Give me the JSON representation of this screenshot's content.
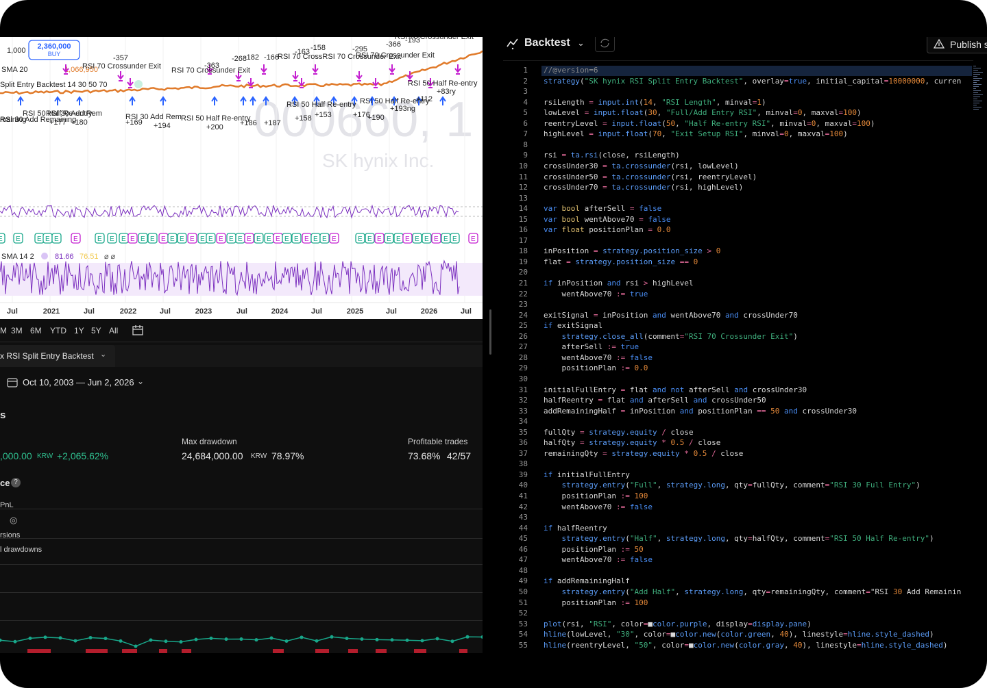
{
  "chart": {
    "price_scale_label": "1,000",
    "order_badge": {
      "value": "2,360,000",
      "side": "BUY"
    },
    "watermark_ticker": "000660, 1",
    "watermark_name": "SK hynix Inc.",
    "sma_label": "SMA 20",
    "sma_value": "1,066,950",
    "strategy_overlay_label": "Split Entry Backtest 14 30 50 70",
    "rsi_pane_label": "SMA 14 2",
    "rsi_value_1": "81.66",
    "rsi_value_2": "76.51",
    "x_axis": [
      "Jul",
      "2021",
      "Jul",
      "2022",
      "Jul",
      "2023",
      "Jul",
      "2024",
      "Jul",
      "2025",
      "Jul",
      "2026",
      "Jul"
    ],
    "trade_labels": [
      "-357",
      "RSI 70 Crossunder Exit",
      "RSI 70 Crossunder Exit",
      "-363",
      "-268",
      "-182",
      "-166",
      "-163",
      "-158",
      "RSI 70 CrossRSI 70 Crossunder Exit",
      "-295",
      "RSI 70 Crossunder Exit",
      "-366",
      "-193",
      "RSI 70 Crossunder Exit",
      "RSI 50 Half Re-entry",
      "RSI 50 Half Re-entry",
      "+83ry",
      "+112",
      "RSI 50 Half Re-entry",
      "+193ng",
      "RSI 50 Half Re-entry",
      "RSI 30 Add Rem",
      "RSI 30 Add Remaining",
      "+177",
      "+180",
      "+169",
      "+194",
      "RSI 30 Add Rem",
      "RSI 50 Half Re-entry",
      "+200",
      "+186",
      "+187",
      "+158",
      "+153",
      "+176",
      "+190",
      "maining"
    ]
  },
  "range_bar": {
    "items": [
      "M",
      "3M",
      "6M",
      "YTD",
      "1Y",
      "5Y",
      "All"
    ],
    "calendar_icon": "calendar-range-icon"
  },
  "strategy_tester": {
    "tab_label": "x RSI Split Entry Backtest",
    "date_range": "Oct 10, 2003 — Jun 2, 2026",
    "section_title": "s",
    "metrics": [
      {
        "label": "",
        "value": ",000.00",
        "unit": "KRW",
        "pct": "+2,065.62%"
      },
      {
        "label": "Max drawdown",
        "value": "24,684,000.00",
        "unit": "KRW",
        "pct": "78.97%"
      },
      {
        "label": "Profitable trades",
        "value": "73.68%",
        "unit": "",
        "pct": "42/57"
      }
    ],
    "perf_title": "ce",
    "perf_rows": [
      "PnL",
      "",
      "rsions",
      "l drawdowns"
    ]
  },
  "editor": {
    "title": "Backtest",
    "publish_label": "Publish s",
    "code_lines": [
      "//@version=6",
      "strategy(\"SK hynix RSI Split Entry Backtest\", overlay=true, initial_capital=10000000, curren",
      "",
      "rsiLength = input.int(14, \"RSI Length\", minval=1)",
      "lowLevel = input.float(30, \"Full/Add Entry RSI\", minval=0, maxval=100)",
      "reentryLevel = input.float(50, \"Half Re-entry RSI\", minval=0, maxval=100)",
      "highLevel = input.float(70, \"Exit Setup RSI\", minval=0, maxval=100)",
      "",
      "rsi = ta.rsi(close, rsiLength)",
      "crossUnder30 = ta.crossunder(rsi, lowLevel)",
      "crossUnder50 = ta.crossunder(rsi, reentryLevel)",
      "crossUnder70 = ta.crossunder(rsi, highLevel)",
      "",
      "var bool afterSell = false",
      "var bool wentAbove70 = false",
      "var float positionPlan = 0.0",
      "",
      "inPosition = strategy.position_size > 0",
      "flat = strategy.position_size == 0",
      "",
      "if inPosition and rsi > highLevel",
      "    wentAbove70 := true",
      "",
      "exitSignal = inPosition and wentAbove70 and crossUnder70",
      "if exitSignal",
      "    strategy.close_all(comment=\"RSI 70 Crossunder Exit\")",
      "    afterSell := true",
      "    wentAbove70 := false",
      "    positionPlan := 0.0",
      "",
      "initialFullEntry = flat and not afterSell and crossUnder30",
      "halfReentry = flat and afterSell and crossUnder50",
      "addRemainingHalf = inPosition and positionPlan == 50 and crossUnder30",
      "",
      "fullQty = strategy.equity / close",
      "halfQty = strategy.equity * 0.5 / close",
      "remainingQty = strategy.equity * 0.5 / close",
      "",
      "if initialFullEntry",
      "    strategy.entry(\"Full\", strategy.long, qty=fullQty, comment=\"RSI 30 Full Entry\")",
      "    positionPlan := 100",
      "    wentAbove70 := false",
      "",
      "if halfReentry",
      "    strategy.entry(\"Half\", strategy.long, qty=halfQty, comment=\"RSI 50 Half Re-entry\")",
      "    positionPlan := 50",
      "    wentAbove70 := false",
      "",
      "if addRemainingHalf",
      "    strategy.entry(\"Add Half\", strategy.long, qty=remainingQty, comment=\"RSI 30 Add Remainin",
      "    positionPlan := 100",
      "",
      "plot(rsi, \"RSI\", color=■color.purple, display=display.pane)",
      "hline(lowLevel, \"30\", color=■color.new(color.green, 40), linestyle=hline.style_dashed)",
      "hline(reentryLevel, \"50\", color=■color.new(color.gray, 40), linestyle=hline.style_dashed)"
    ]
  },
  "colors": {
    "rsi_line": "#7b2fbf",
    "price_line": "#e07a2a",
    "buy_arrow": "#2962ff",
    "exit_marker": "#c41fd0",
    "equity_line": "#18a78a",
    "panel_bg": "#0f0f0f"
  }
}
